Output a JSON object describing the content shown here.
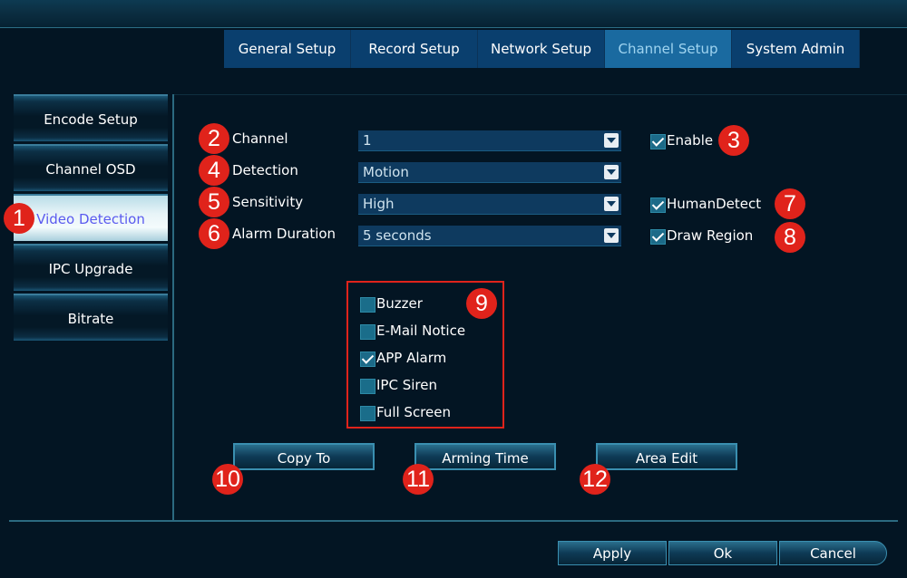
{
  "top_tabs": [
    {
      "label": "General Setup"
    },
    {
      "label": "Record Setup"
    },
    {
      "label": "Network Setup"
    },
    {
      "label": "Channel Setup"
    },
    {
      "label": "System Admin"
    }
  ],
  "active_top_tab": "Channel Setup",
  "sidebar": {
    "items": [
      {
        "label": "Encode Setup"
      },
      {
        "label": "Channel OSD"
      },
      {
        "label": "Video Detection"
      },
      {
        "label": "IPC Upgrade"
      },
      {
        "label": "Bitrate"
      }
    ],
    "active": "Video Detection"
  },
  "form": {
    "channel": {
      "label": "Channel",
      "value": "1"
    },
    "detection": {
      "label": "Detection",
      "value": "Motion"
    },
    "sensitivity": {
      "label": "Sensitivity",
      "value": "High"
    },
    "alarm_duration": {
      "label": "Alarm Duration",
      "value": "5 seconds"
    },
    "enable": {
      "label": "Enable",
      "checked": true
    },
    "human_detect": {
      "label": "HumanDetect",
      "checked": true
    },
    "draw_region": {
      "label": "Draw Region",
      "checked": true
    }
  },
  "alarm_options": [
    {
      "label": "Buzzer",
      "checked": false
    },
    {
      "label": "E-Mail Notice",
      "checked": false
    },
    {
      "label": "APP Alarm",
      "checked": true
    },
    {
      "label": "IPC Siren",
      "checked": false
    },
    {
      "label": "Full Screen",
      "checked": false
    }
  ],
  "actions": {
    "copy_to": "Copy To",
    "arming_time": "Arming Time",
    "area_edit": "Area Edit"
  },
  "footer": {
    "apply": "Apply",
    "ok": "Ok",
    "cancel": "Cancel"
  },
  "badges": [
    "1",
    "2",
    "3",
    "4",
    "5",
    "6",
    "7",
    "8",
    "9",
    "10",
    "11",
    "12"
  ],
  "colors": {
    "background": "#031523",
    "tab_bg": "#0a3f6e",
    "tab_active_bg": "#1a6aa0",
    "badge_red": "#e0231b",
    "sidebar_active_text": "#5a5aef"
  }
}
